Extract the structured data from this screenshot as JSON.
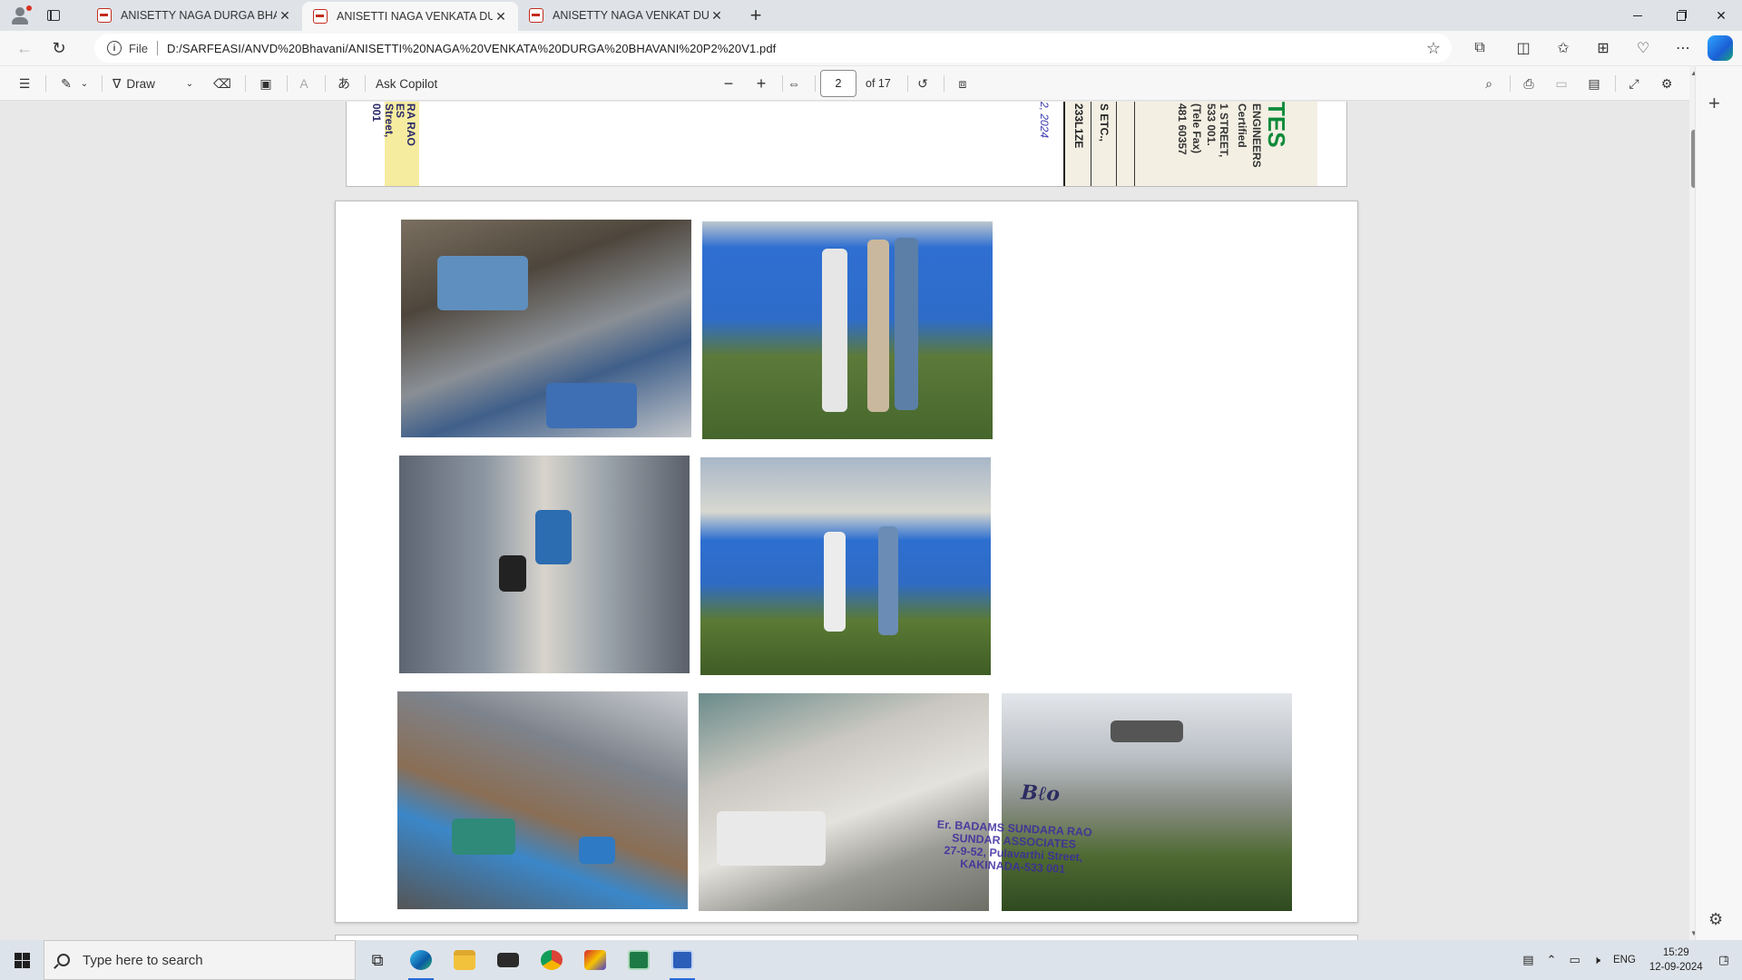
{
  "tabs": [
    {
      "label": "ANISETTY NAGA DURGA BHAVANI",
      "active": false
    },
    {
      "label": "ANISETTI NAGA VENKATA DURGA",
      "active": true
    },
    {
      "label": "ANISETTY NAGA VENKAT DURGA",
      "active": false
    }
  ],
  "address": {
    "scheme": "File",
    "url": "D:/SARFEASI/ANVD%20Bhavani/ANISETTI%20NAGA%20VENKATA%20DURGA%20BHAVANI%20P2%20V1.pdf"
  },
  "pdf_toolbar": {
    "draw_label": "Draw",
    "ask_copilot_label": "Ask Copilot",
    "current_page": "2",
    "page_count_label": "of 17"
  },
  "document": {
    "page1_fragments": {
      "left_col1": "RA RAO",
      "left_col2": "ES",
      "left_col3": "Street,",
      "left_col4": "001",
      "date": "2, 2024",
      "cin": "233L1ZE",
      "ses": "S ETC.,",
      "phone": "481 60357",
      "tele": "(Tele Fax)",
      "pin": "533 001.",
      "street": "1 STREET,",
      "certified": "Certified",
      "engineers": "ENGINEERS",
      "logo": "TES"
    },
    "stamp": {
      "line1": "Er. BADAMS SUNDARA RAO",
      "line2": "SUNDAR ASSOCIATES",
      "line3": "27-9-52, Pulavarthi Street,",
      "line4": "KAKINADA-533 001"
    }
  },
  "taskbar": {
    "search_placeholder": "Type here to search",
    "lang": "ENG",
    "time": "15:29",
    "date": "12-09-2024",
    "notifications": "1"
  }
}
